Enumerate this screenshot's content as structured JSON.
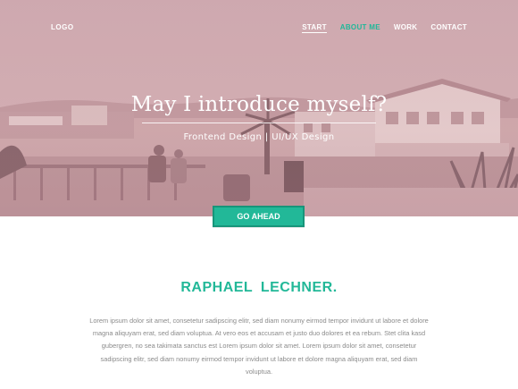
{
  "header": {
    "logo": "LOGO",
    "nav": [
      {
        "label": "START"
      },
      {
        "label": "ABOUT ME"
      },
      {
        "label": "WORK"
      },
      {
        "label": "CONTACT"
      }
    ]
  },
  "hero": {
    "title": "May I introduce myself?",
    "subtitle": "Frontend Design | UI/UX Design",
    "cta_label": "GO AHEAD"
  },
  "about": {
    "name": "RAPHAEL  LECHNER.",
    "bio": "Lorem ipsum dolor sit amet, consetetur sadipscing elitr, sed diam nonumy eirmod tempor invidunt ut labore et dolore magna aliquyam erat, sed diam voluptua. At vero eos et accusam et justo duo dolores et ea rebum. Stet clita kasd gubergren, no sea takimata sanctus est Lorem ipsum dolor sit amet. Lorem ipsum dolor sit amet, consetetur sadipscing elitr, sed diam nonumy eirmod tempor invidunt ut labore et dolore magna aliquyam erat, sed diam voluptua."
  },
  "colors": {
    "accent": "#22b898",
    "accent_dark": "#17957a",
    "hero_tint": "#d3b1b5",
    "body_text": "#8b8b8b"
  }
}
